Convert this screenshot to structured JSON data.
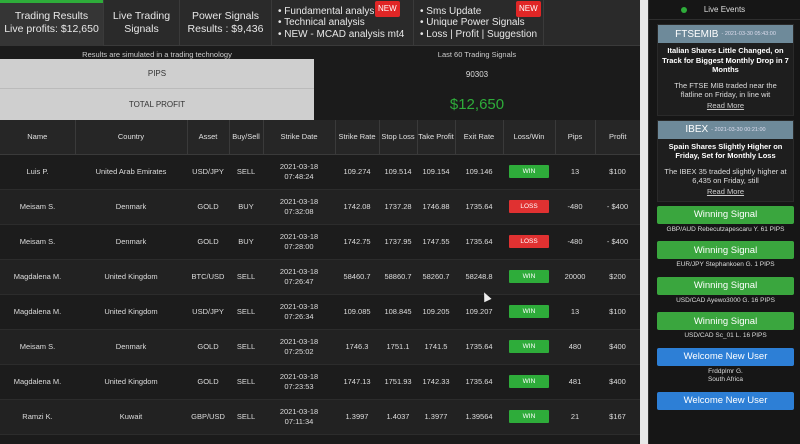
{
  "nav": {
    "tabs": [
      {
        "line1": "Trading Results",
        "line2": "Live profits: $12,650"
      },
      {
        "line1": "Live Trading",
        "line2": "Signals"
      },
      {
        "line1": "Power Signals",
        "line2": "Results : $9,436"
      }
    ],
    "features1": {
      "items": [
        "Fundamental analysis",
        "Technical analysis",
        "NEW - MCAD analysis mt4"
      ],
      "badge": "NEW"
    },
    "features2": {
      "items": [
        "Sms Update",
        "Unique Power Signals",
        "Loss | Profit | Suggestion"
      ],
      "badge": "NEW"
    }
  },
  "results": {
    "note_left": "Results are simulated in a trading technology",
    "note_right": "Last 60 Trading Signals",
    "pips_label": "PIPS",
    "pips_value": "90303",
    "profit_label": "TOTAL PROFIT",
    "profit_value": "$12,650"
  },
  "table": {
    "headers": [
      "Name",
      "Country",
      "Asset",
      "Buy/Sell",
      "Strike Date",
      "Strike Rate",
      "Stop Loss",
      "Take Profit",
      "Exit Rate",
      "Loss/Win",
      "Pips",
      "Profit"
    ],
    "rows": [
      {
        "name": "Luis P.",
        "country": "United Arab Emirates",
        "asset": "USD/JPY",
        "side": "SELL",
        "date": "2021-03-18",
        "time": "07:48:24",
        "strike": "109.274",
        "stop": "109.514",
        "take": "109.154",
        "exit": "109.146",
        "result": "WIN",
        "pips": "13",
        "profit": "$100"
      },
      {
        "name": "Meisam S.",
        "country": "Denmark",
        "asset": "GOLD",
        "side": "BUY",
        "date": "2021-03-18",
        "time": "07:32:08",
        "strike": "1742.08",
        "stop": "1737.28",
        "take": "1746.88",
        "exit": "1735.64",
        "result": "LOSS",
        "pips": "-480",
        "profit": "- $400"
      },
      {
        "name": "Meisam S.",
        "country": "Denmark",
        "asset": "GOLD",
        "side": "BUY",
        "date": "2021-03-18",
        "time": "07:28:00",
        "strike": "1742.75",
        "stop": "1737.95",
        "take": "1747.55",
        "exit": "1735.64",
        "result": "LOSS",
        "pips": "-480",
        "profit": "- $400"
      },
      {
        "name": "Magdalena M.",
        "country": "United Kingdom",
        "asset": "BTC/USD",
        "side": "SELL",
        "date": "2021-03-18",
        "time": "07:26:47",
        "strike": "58460.7",
        "stop": "58860.7",
        "take": "58260.7",
        "exit": "58248.8",
        "result": "WIN",
        "pips": "20000",
        "profit": "$200"
      },
      {
        "name": "Magdalena M.",
        "country": "United Kingdom",
        "asset": "USD/JPY",
        "side": "SELL",
        "date": "2021-03-18",
        "time": "07:26:34",
        "strike": "109.085",
        "stop": "108.845",
        "take": "109.205",
        "exit": "109.207",
        "result": "WIN",
        "pips": "13",
        "profit": "$100"
      },
      {
        "name": "Meisam S.",
        "country": "Denmark",
        "asset": "GOLD",
        "side": "SELL",
        "date": "2021-03-18",
        "time": "07:25:02",
        "strike": "1746.3",
        "stop": "1751.1",
        "take": "1741.5",
        "exit": "1735.64",
        "result": "WIN",
        "pips": "480",
        "profit": "$400"
      },
      {
        "name": "Magdalena M.",
        "country": "United Kingdom",
        "asset": "GOLD",
        "side": "SELL",
        "date": "2021-03-18",
        "time": "07:23:53",
        "strike": "1747.13",
        "stop": "1751.93",
        "take": "1742.33",
        "exit": "1735.64",
        "result": "WIN",
        "pips": "481",
        "profit": "$400"
      },
      {
        "name": "Ramzi K.",
        "country": "Kuwait",
        "asset": "GBP/USD",
        "side": "SELL",
        "date": "2021-03-18",
        "time": "07:11:34",
        "strike": "1.3997",
        "stop": "1.4037",
        "take": "1.3977",
        "exit": "1.39564",
        "result": "WIN",
        "pips": "21",
        "profit": "$167"
      }
    ]
  },
  "sidebar": {
    "title": "Live Events",
    "news": [
      {
        "tag": "FTSEMIB",
        "date": "- 2021-03-30 05:43:00",
        "title": "Italian Shares Little Changed, on Track for Biggest Monthly Drop in 7 Months",
        "body": "The FTSE MIB traded near the flatline on Friday, in line wit",
        "more": "Read More"
      },
      {
        "tag": "IBEX",
        "date": "- 2021-03-30 00:21:00",
        "title": "Spain Shares Slightly Higher on Friday, Set for Monthly Loss",
        "body": "The IBEX 35 traded slightly higher at 6,435 on Friday, still",
        "more": "Read More"
      }
    ],
    "events": [
      {
        "label": "Winning Signal",
        "detail": "GBP/AUD Rebecutzapescaru Y. 61 PIPS",
        "color": "green"
      },
      {
        "label": "Winning Signal",
        "detail": "EUR/JPY Stephankoen G. 1 PIPS",
        "color": "green"
      },
      {
        "label": "Winning Signal",
        "detail": "USD/CAD Ayewo3000 G. 16 PIPS",
        "color": "green"
      },
      {
        "label": "Winning Signal",
        "detail": "USD/CAD Sc_01 L. 16 PIPS",
        "color": "green"
      },
      {
        "label": "Welcome New User",
        "detail": "Frddplmr G.\nSouth Africa",
        "color": "blue"
      },
      {
        "label": "Welcome New User",
        "detail": "",
        "color": "blue"
      }
    ]
  }
}
